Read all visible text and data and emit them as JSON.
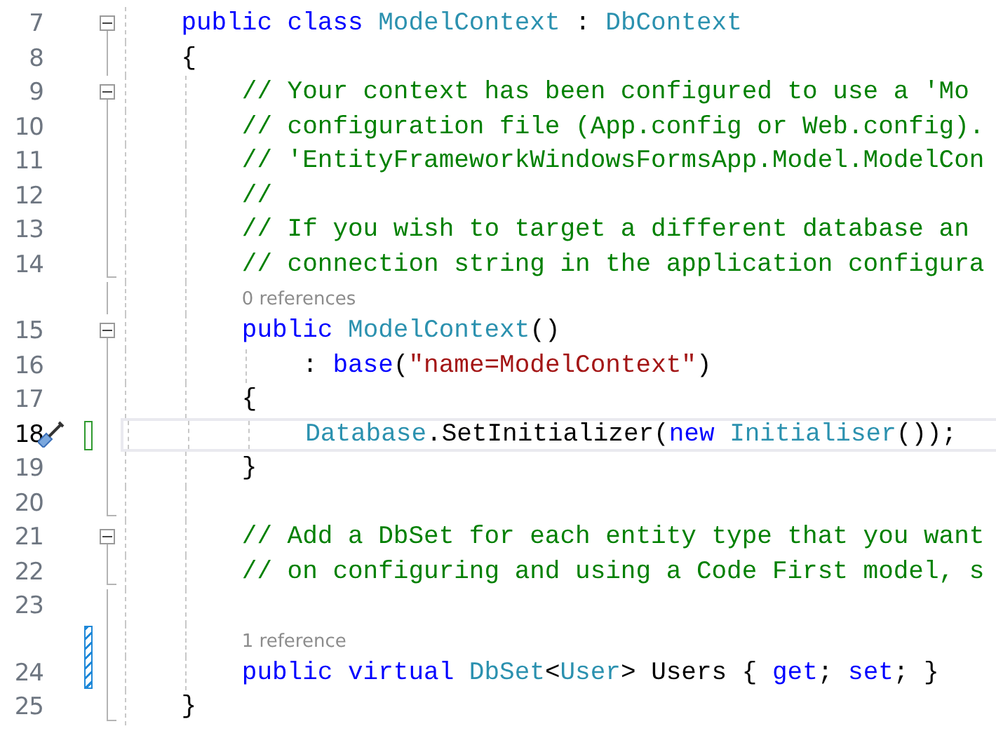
{
  "editor": {
    "lines": [
      {
        "kind": "code",
        "number": "7",
        "current": false,
        "quick_action": false,
        "collapsible": true,
        "region_end": false,
        "tokens": [
          {
            "text": "public class ",
            "kind": "keyword"
          },
          {
            "text": "ModelContext",
            "kind": "type"
          },
          {
            "text": " : ",
            "kind": "plain"
          },
          {
            "text": "DbContext",
            "kind": "type"
          }
        ]
      },
      {
        "kind": "code",
        "number": "8",
        "current": false,
        "quick_action": false,
        "collapsible": false,
        "region_end": false,
        "tokens": [
          {
            "text": "{",
            "kind": "plain"
          }
        ],
        "children": [
          {
            "kind": "code",
            "number": "9",
            "current": false,
            "quick_action": false,
            "collapsible": true,
            "region_end": false,
            "tokens": [
              {
                "text": "// Your context has been configured to use a 'Mo",
                "kind": "comment"
              }
            ]
          },
          {
            "kind": "code",
            "number": "10",
            "current": false,
            "quick_action": false,
            "collapsible": false,
            "region_end": false,
            "tokens": [
              {
                "text": "// configuration file (App.config or Web.config).",
                "kind": "comment"
              }
            ]
          },
          {
            "kind": "code",
            "number": "11",
            "current": false,
            "quick_action": false,
            "collapsible": false,
            "region_end": false,
            "tokens": [
              {
                "text": "// 'EntityFrameworkWindowsFormsApp.Model.ModelCon",
                "kind": "comment"
              }
            ]
          },
          {
            "kind": "code",
            "number": "12",
            "current": false,
            "quick_action": false,
            "collapsible": false,
            "region_end": false,
            "tokens": [
              {
                "text": "//",
                "kind": "comment"
              }
            ]
          },
          {
            "kind": "code",
            "number": "13",
            "current": false,
            "quick_action": false,
            "collapsible": false,
            "region_end": false,
            "tokens": [
              {
                "text": "// If you wish to target a different database an",
                "kind": "comment"
              }
            ]
          },
          {
            "kind": "code",
            "number": "14",
            "current": false,
            "quick_action": false,
            "collapsible": false,
            "region_end": true,
            "tokens": [
              {
                "text": "// connection string in the application configura",
                "kind": "comment"
              }
            ]
          },
          {
            "kind": "lens",
            "text": "0 references"
          },
          {
            "kind": "code",
            "number": "15",
            "current": false,
            "quick_action": false,
            "collapsible": true,
            "region_end": false,
            "tokens": [
              {
                "text": "public ",
                "kind": "keyword"
              },
              {
                "text": "ModelContext",
                "kind": "type"
              },
              {
                "text": "()",
                "kind": "plain"
              }
            ],
            "children": [
              {
                "kind": "code",
                "number": "16",
                "current": false,
                "quick_action": false,
                "collapsible": false,
                "region_end": false,
                "tokens": [
                  {
                    "text": ": ",
                    "kind": "plain"
                  },
                  {
                    "text": "base",
                    "kind": "keyword"
                  },
                  {
                    "text": "(",
                    "kind": "plain"
                  },
                  {
                    "text": "\"name=ModelContext\"",
                    "kind": "string"
                  },
                  {
                    "text": ")",
                    "kind": "plain"
                  }
                ]
              }
            ]
          },
          {
            "kind": "code",
            "number": "17",
            "current": false,
            "quick_action": false,
            "collapsible": false,
            "region_end": false,
            "tokens": [
              {
                "text": "{",
                "kind": "plain"
              }
            ],
            "children": [
              {
                "kind": "code",
                "number": "18",
                "current": true,
                "quick_action": true,
                "collapsible": false,
                "region_end": false,
                "change": {
                  "kind": "outline",
                  "color": "#2f9a2f"
                },
                "tokens": [
                  {
                    "text": "Database",
                    "kind": "type"
                  },
                  {
                    "text": ".SetInitializer(",
                    "kind": "plain"
                  },
                  {
                    "text": "new ",
                    "kind": "keyword"
                  },
                  {
                    "text": "Initialiser",
                    "kind": "type"
                  },
                  {
                    "text": "());",
                    "kind": "plain"
                  }
                ]
              }
            ]
          },
          {
            "kind": "code",
            "number": "19",
            "current": false,
            "quick_action": false,
            "collapsible": false,
            "region_end": false,
            "tokens": [
              {
                "text": "}",
                "kind": "plain"
              }
            ]
          },
          {
            "kind": "code",
            "number": "20",
            "current": false,
            "quick_action": false,
            "collapsible": false,
            "region_end": true
          },
          {
            "kind": "code",
            "number": "21",
            "current": false,
            "quick_action": false,
            "collapsible": true,
            "region_end": false,
            "tokens": [
              {
                "text": "// Add a DbSet for each entity type that you want",
                "kind": "comment"
              }
            ]
          },
          {
            "kind": "code",
            "number": "22",
            "current": false,
            "quick_action": false,
            "collapsible": false,
            "region_end": true,
            "tokens": [
              {
                "text": "// on configuring and using a Code First model, s",
                "kind": "comment"
              }
            ]
          },
          {
            "kind": "code",
            "number": "23",
            "current": false,
            "quick_action": false,
            "collapsible": false,
            "region_end": false
          },
          {
            "kind": "lens",
            "text": "1 reference"
          },
          {
            "kind": "code",
            "number": "24",
            "current": false,
            "quick_action": false,
            "collapsible": false,
            "region_end": false,
            "change": {
              "kind": "hatched",
              "color": "#1e88d8"
            },
            "tokens": [
              {
                "text": "public virtual ",
                "kind": "keyword"
              },
              {
                "text": "DbSet",
                "kind": "type"
              },
              {
                "text": "<",
                "kind": "plain"
              },
              {
                "text": "User",
                "kind": "type"
              },
              {
                "text": "> Users { ",
                "kind": "plain"
              },
              {
                "text": "get",
                "kind": "keyword"
              },
              {
                "text": "; ",
                "kind": "plain"
              },
              {
                "text": "set",
                "kind": "keyword"
              },
              {
                "text": "; }",
                "kind": "plain"
              }
            ]
          }
        ]
      },
      {
        "kind": "code",
        "number": "25",
        "current": false,
        "quick_action": false,
        "collapsible": false,
        "region_end": true,
        "tokens": [
          {
            "text": "}",
            "kind": "plain"
          }
        ]
      }
    ]
  }
}
